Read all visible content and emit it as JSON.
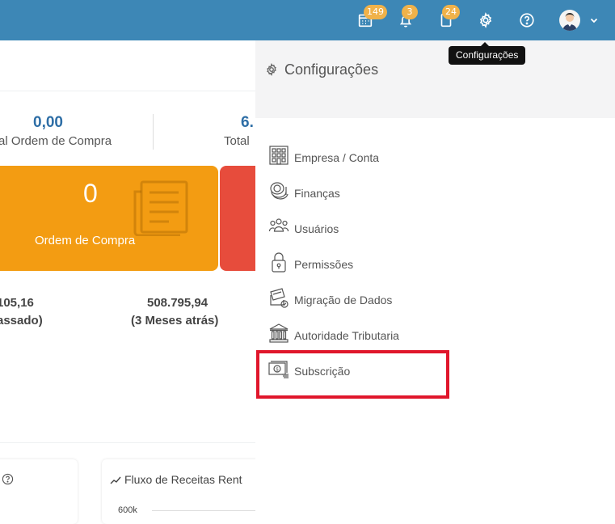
{
  "topbar": {
    "badges": {
      "calendar": "149",
      "notifications": "3",
      "tasks": "24"
    },
    "tooltip": "Configurações"
  },
  "dashboard": {
    "kpi1_value": "0,00",
    "kpi1_label": "al Ordem de Compra",
    "kpi2_value": "6.",
    "kpi2_label": "Total",
    "card_value": "0",
    "card_label": "Ordem de Compra",
    "stat1_value": "105,16",
    "stat1_label": "assado)",
    "stat2_value": "508.795,94",
    "stat2_label": "(3 Meses atrás)",
    "chart_title": "Fluxo de Receitas Rent",
    "chart_axis_label": "600k"
  },
  "panel": {
    "title": "Configurações",
    "items": [
      {
        "label": "Empresa / Conta",
        "icon": "building-icon"
      },
      {
        "label": "Finanças",
        "icon": "coins-icon"
      },
      {
        "label": "Usuários",
        "icon": "users-icon"
      },
      {
        "label": "Permissões",
        "icon": "lock-icon"
      },
      {
        "label": "Migração de Dados",
        "icon": "data-migration-icon"
      },
      {
        "label": "Autoridade Tributaria",
        "icon": "bank-icon"
      },
      {
        "label": "Subscrição",
        "icon": "banknote-icon"
      }
    ]
  },
  "colors": {
    "topbar": "#3d87b6",
    "badge": "#f0b24a",
    "kpi_blue": "#2e6ea6",
    "card_orange": "#f39c12",
    "card_red": "#e74c3c",
    "highlight": "#e0162b"
  }
}
